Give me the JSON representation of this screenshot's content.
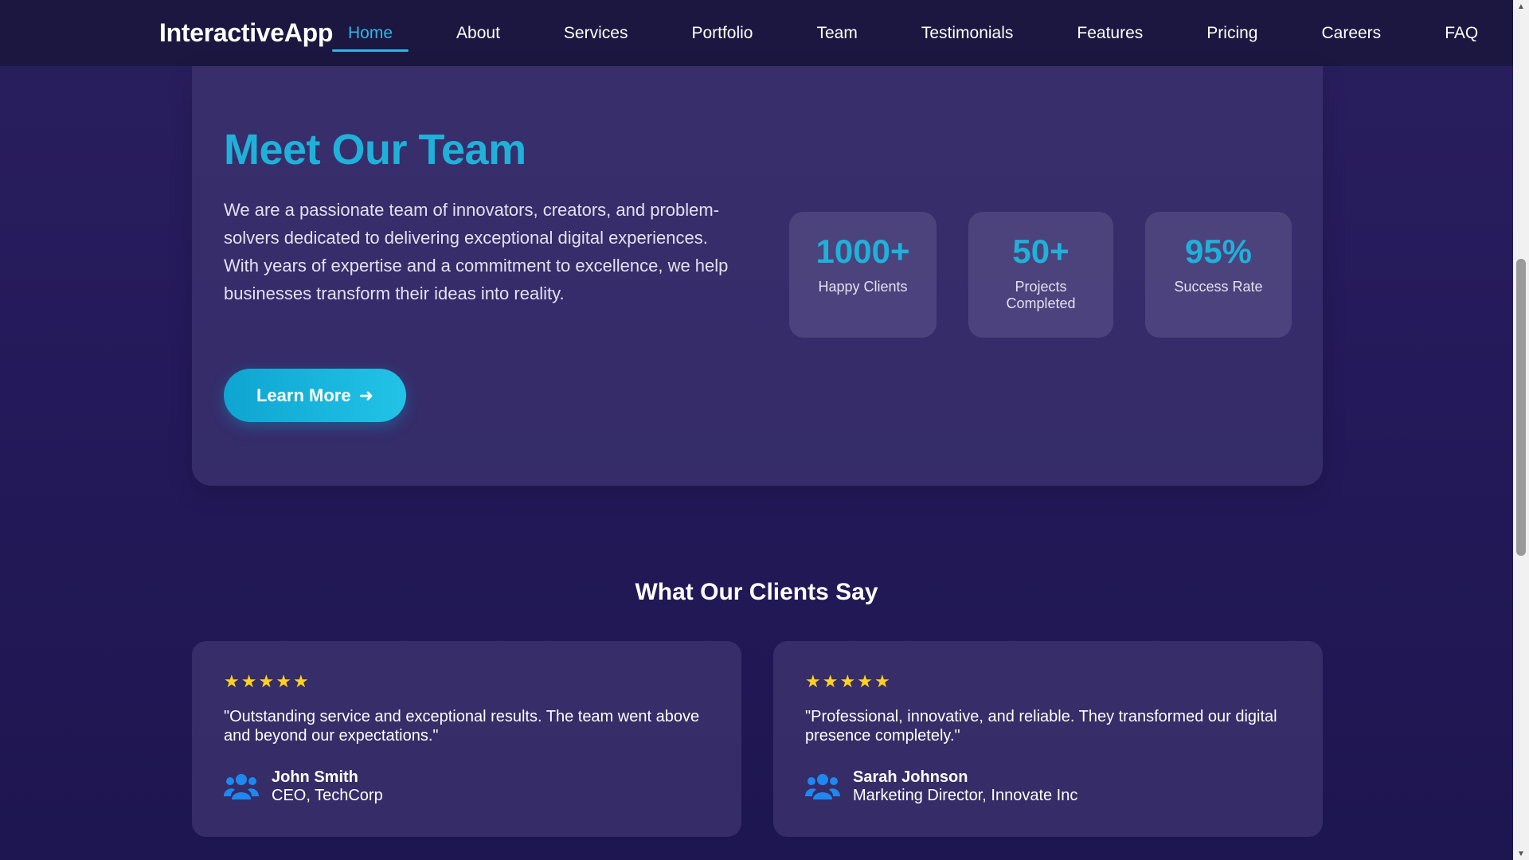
{
  "nav": {
    "brand": "InteractiveApp",
    "links": [
      {
        "label": "Home",
        "active": true
      },
      {
        "label": "About"
      },
      {
        "label": "Services"
      },
      {
        "label": "Portfolio"
      },
      {
        "label": "Team"
      },
      {
        "label": "Testimonials"
      },
      {
        "label": "Features"
      },
      {
        "label": "Pricing"
      },
      {
        "label": "Careers"
      },
      {
        "label": "FAQ"
      }
    ]
  },
  "hero": {
    "title": "Meet Our Team",
    "description": "We are a passionate team of innovators, creators, and problem-solvers dedicated to delivering exceptional digital experiences. With years of expertise and a commitment to excellence, we help businesses transform their ideas into reality.",
    "button_label": "Learn More",
    "button_icon": "arrow-right-icon",
    "stats": [
      {
        "value": "1000+",
        "label": "Happy Clients"
      },
      {
        "value": "50+",
        "label": "Projects Completed"
      },
      {
        "value": "95%",
        "label": "Success Rate"
      }
    ]
  },
  "testimonials": {
    "title": "What Our Clients Say",
    "items": [
      {
        "rating": 5,
        "quote": "\"Outstanding service and exceptional results. The team went above and beyond our expectations.\"",
        "name": "John Smith",
        "role": "CEO, TechCorp",
        "icon": "users-icon"
      },
      {
        "rating": 5,
        "quote": "\"Professional, innovative, and reliable. They transformed our digital presence completely.\"",
        "name": "Sarah Johnson",
        "role": "Marketing Director, Innovate Inc",
        "icon": "users-icon"
      }
    ]
  },
  "colors": {
    "accent": "#1fb1d9",
    "star": "#ffd21f",
    "icon_blue": "#1e88f0",
    "nav_bg": "#1b1740"
  }
}
